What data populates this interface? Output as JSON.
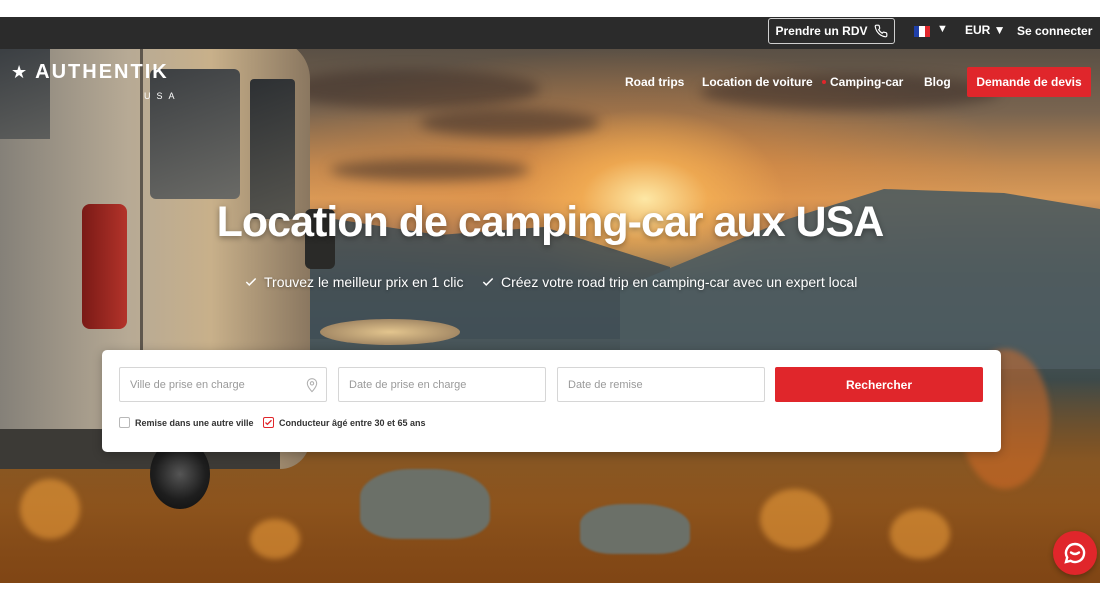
{
  "topbar": {
    "appointment_label": "Prendre un RDV",
    "language_caret": "▼",
    "currency": "EUR ▼",
    "login_label": "Se connecter"
  },
  "brand": {
    "name": "AUTHENTIK",
    "sub": "USA",
    "star": "★"
  },
  "nav": {
    "items": [
      {
        "label": "Road trips"
      },
      {
        "label": "Location de voiture"
      },
      {
        "label": "Camping-car"
      },
      {
        "label": "Blog"
      }
    ],
    "quote_button": "Demande de devis"
  },
  "hero": {
    "title": "Location de camping-car aux USA",
    "bullets": [
      "Trouvez le meilleur prix en 1 clic",
      "Créez votre road trip en camping-car avec un expert local"
    ]
  },
  "search": {
    "pickup_city_placeholder": "Ville de prise en charge",
    "pickup_date_placeholder": "Date de prise en charge",
    "return_date_placeholder": "Date de remise",
    "submit_label": "Rechercher",
    "options": [
      {
        "label": "Remise dans une autre ville",
        "checked": false
      },
      {
        "label": "Conducteur âgé entre 30 et 65 ans",
        "checked": true
      }
    ]
  },
  "colors": {
    "accent": "#e0262b",
    "topbar": "#2b2b2b"
  },
  "icons": {
    "phone": "phone-icon",
    "flag": "france-flag-icon",
    "check": "check-icon",
    "location": "location-pin-icon",
    "chat": "chat-icon"
  }
}
